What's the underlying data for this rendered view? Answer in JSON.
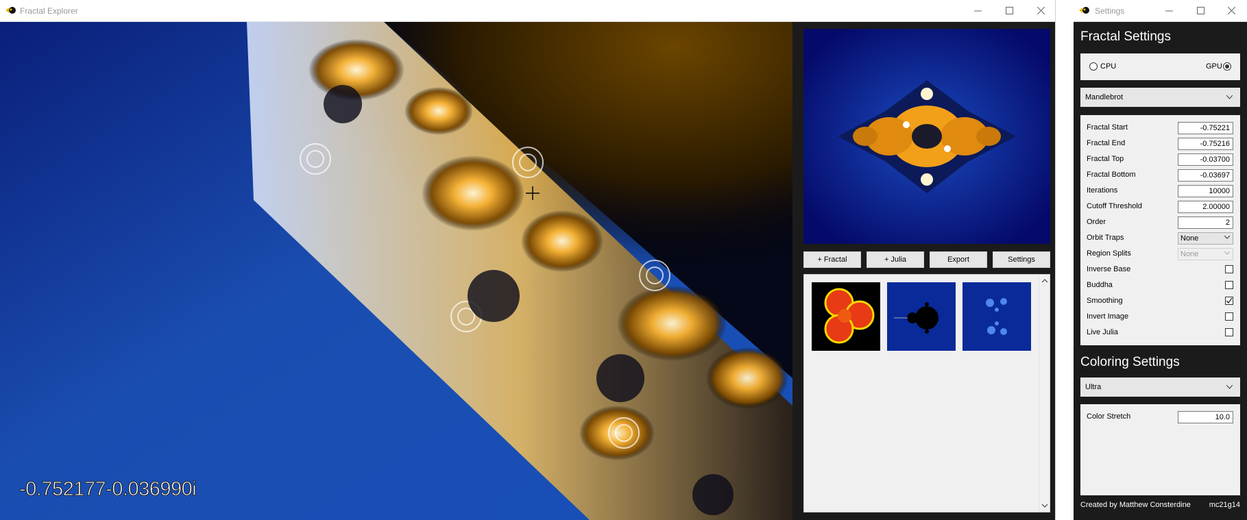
{
  "main_window": {
    "title": "Fractal Explorer",
    "coordinate_readout": "-0.752177-0.036990i",
    "buttons": {
      "add_fractal": "+ Fractal",
      "add_julia": "+ Julia",
      "export": "Export",
      "settings": "Settings"
    },
    "thumbnails": [
      {
        "name": "thumbnail-clover"
      },
      {
        "name": "thumbnail-mandelbrot"
      },
      {
        "name": "thumbnail-blue-julia"
      }
    ]
  },
  "settings_window": {
    "title": "Settings",
    "fractal_settings_heading": "Fractal Settings",
    "mode": {
      "cpu_label": "CPU",
      "gpu_label": "GPU",
      "selected": "GPU"
    },
    "fractal_type": "Mandlebrot",
    "fields": [
      {
        "label": "Fractal Start",
        "value": "-0.75221"
      },
      {
        "label": "Fractal End",
        "value": "-0.75216"
      },
      {
        "label": "Fractal Top",
        "value": "-0.03700"
      },
      {
        "label": "Fractal Bottom",
        "value": "-0.03697"
      },
      {
        "label": "Iterations",
        "value": "10000"
      },
      {
        "label": "Cutoff Threshold",
        "value": "2.00000"
      },
      {
        "label": "Order",
        "value": "2"
      }
    ],
    "orbit_traps": {
      "label": "Orbit Traps",
      "value": "None"
    },
    "region_splits": {
      "label": "Region Splits",
      "value": "None"
    },
    "checkboxes": [
      {
        "label": "Inverse Base",
        "checked": false
      },
      {
        "label": "Buddha",
        "checked": false
      },
      {
        "label": "Smoothing",
        "checked": true
      },
      {
        "label": "Invert Image",
        "checked": false
      },
      {
        "label": "Live Julia",
        "checked": false
      }
    ],
    "coloring_settings_heading": "Coloring Settings",
    "palette": "Ultra",
    "color_stretch": {
      "label": "Color Stretch",
      "value": "10.0"
    },
    "footer": {
      "credit": "Created by Matthew Consterdine",
      "id": "mc21g14"
    }
  },
  "colors": {
    "fractal_blue": "#0a2a8a",
    "fractal_orange": "#f2a019",
    "panel_dark": "#1b1b1b",
    "panel_light": "#f0f0f0"
  }
}
